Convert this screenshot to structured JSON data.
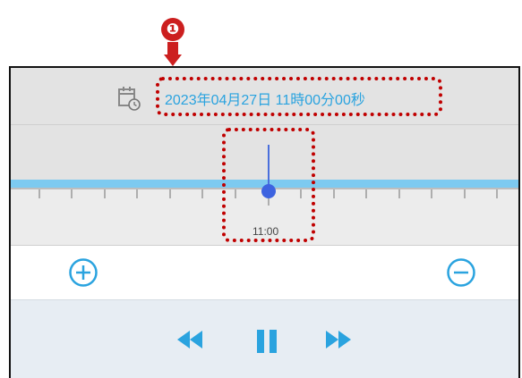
{
  "callout": {
    "number": "❶"
  },
  "datetime": {
    "display": "2023年04月27日 11時00分00秒"
  },
  "timeline": {
    "current_time_label": "11:00"
  },
  "controls": {
    "zoom_in_icon": "plus-circle-icon",
    "zoom_out_icon": "minus-circle-icon",
    "rewind_icon": "rewind-icon",
    "pause_icon": "pause-icon",
    "forward_icon": "fast-forward-icon"
  },
  "colors": {
    "accent": "#2aa3df",
    "timeline_band": "#7dcaf0",
    "playhead": "#3d63e0",
    "highlight": "#c00000"
  }
}
